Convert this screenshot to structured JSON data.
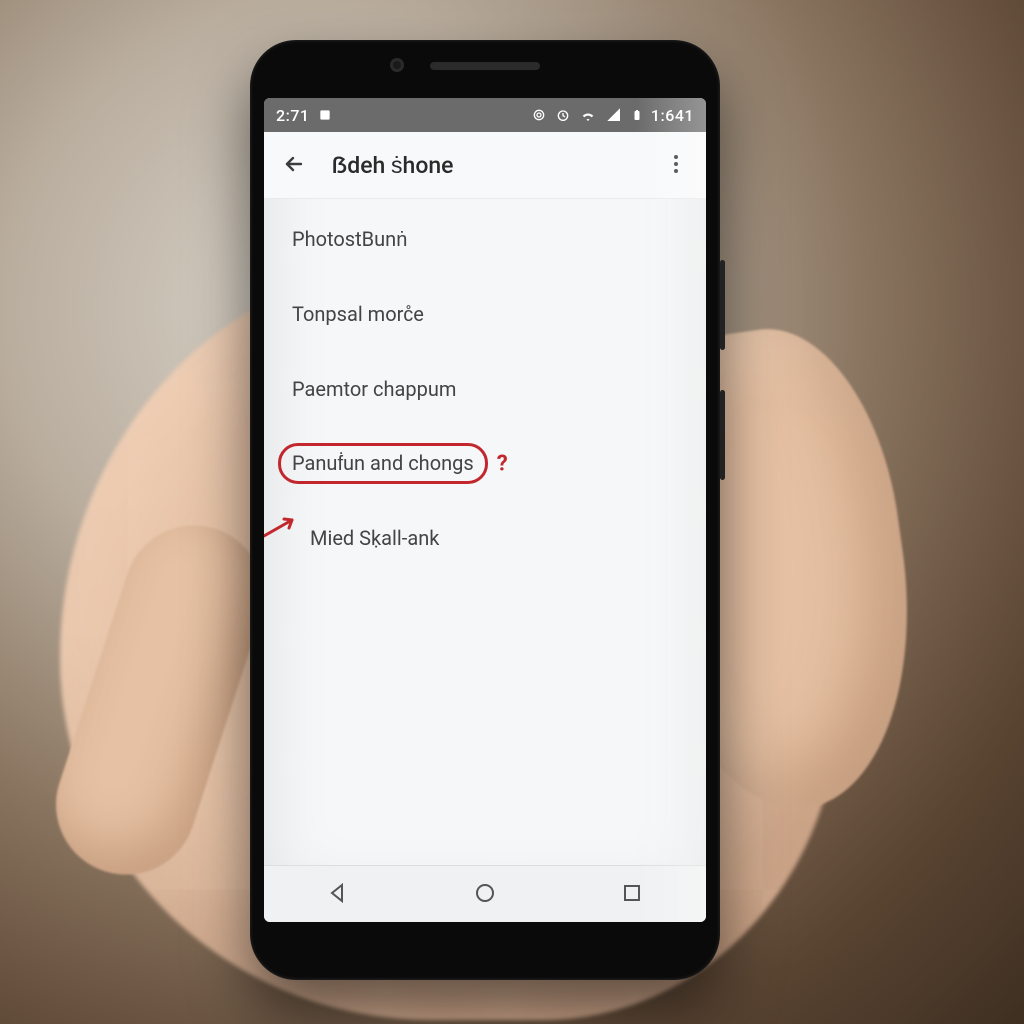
{
  "statusbar": {
    "left_time": "2:71",
    "right_time": "1:641"
  },
  "header": {
    "title": "ẞdeh ṡhone"
  },
  "list": {
    "items": [
      {
        "label": "PhotostBunṅ"
      },
      {
        "label": "Tonpsal morc̊e"
      },
      {
        "label": "Paemtor chappum"
      },
      {
        "label": "Panuḟun and chongs"
      },
      {
        "label": "Mied Sḳall-ank"
      }
    ]
  },
  "annotations": {
    "highlight_index": 3,
    "arrow_index": 4,
    "question_mark": "?"
  }
}
